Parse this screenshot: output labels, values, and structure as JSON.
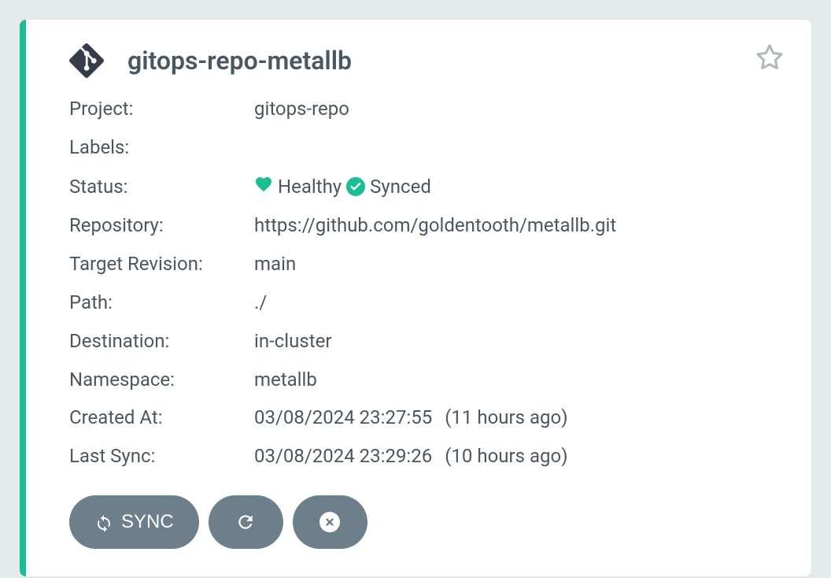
{
  "app": {
    "title": "gitops-repo-metallb"
  },
  "fields": {
    "project_label": "Project:",
    "project_value": "gitops-repo",
    "labels_label": "Labels:",
    "labels_value": "",
    "status_label": "Status:",
    "status_health": "Healthy",
    "status_sync": "Synced",
    "repository_label": "Repository:",
    "repository_value": "https://github.com/goldentooth/metallb.git",
    "target_revision_label": "Target Revision:",
    "target_revision_value": "main",
    "path_label": "Path:",
    "path_value": "./",
    "destination_label": "Destination:",
    "destination_value": "in-cluster",
    "namespace_label": "Namespace:",
    "namespace_value": "metallb",
    "created_at_label": "Created At:",
    "created_at_ts": "03/08/2024 23:27:55",
    "created_at_rel": "(11 hours ago)",
    "last_sync_label": "Last Sync:",
    "last_sync_ts": "03/08/2024 23:29:26",
    "last_sync_rel": "(10 hours ago)"
  },
  "actions": {
    "sync": "SYNC"
  },
  "colors": {
    "accent": "#18BE94",
    "button": "#6D7F8B",
    "text": "#495763"
  }
}
